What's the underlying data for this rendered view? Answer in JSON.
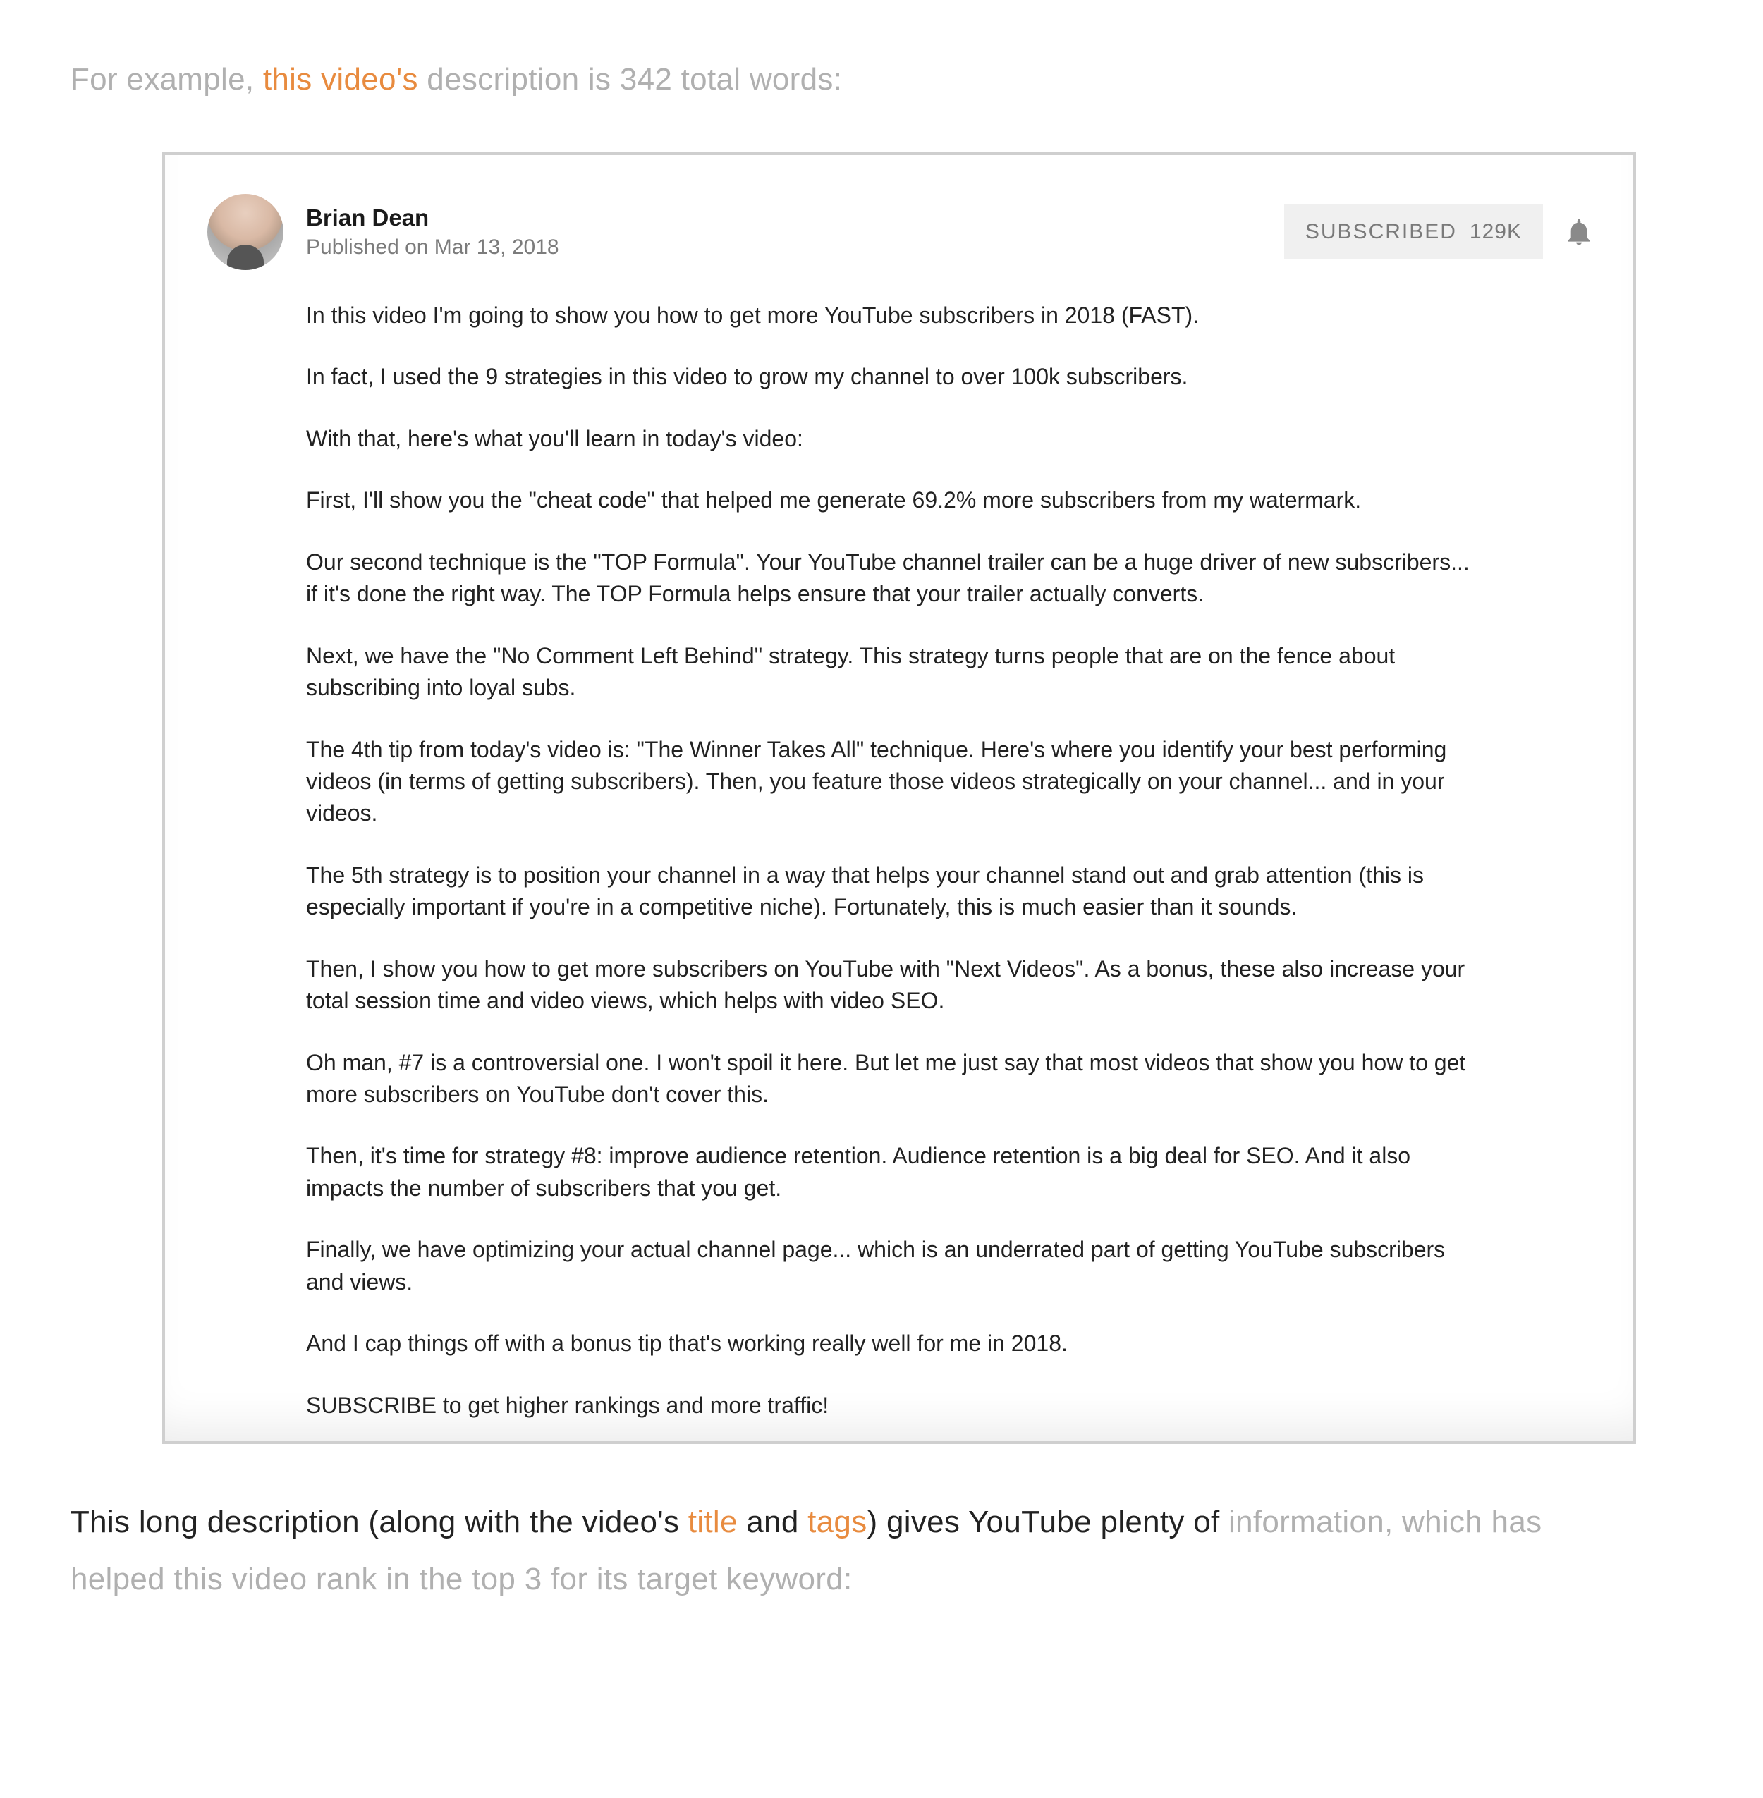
{
  "intro": {
    "before": "For example, ",
    "link": "this video's",
    "after": " description is 342 total words:"
  },
  "card": {
    "author": "Brian Dean",
    "published": "Published on Mar 13, 2018",
    "subscribed_label": "SUBSCRIBED",
    "sub_count": "129K",
    "paragraphs": [
      "In this video I'm going to show you how to get more YouTube subscribers in 2018 (FAST).",
      "In fact, I used the 9 strategies in this video to grow my channel to over 100k subscribers.",
      "With that, here's what you'll learn in today's video:",
      "First, I'll show you the \"cheat code\" that helped me generate 69.2% more subscribers from my watermark.",
      "Our second technique is the \"TOP Formula\". Your YouTube channel trailer can be a huge driver of new subscribers... if it's done the right way. The TOP Formula helps ensure that your trailer actually converts.",
      "Next, we have the \"No Comment Left Behind\" strategy. This strategy turns people that are on the fence about subscribing into loyal subs.",
      "The 4th tip from today's video is: \"The Winner Takes All\" technique. Here's where you identify your best performing videos (in terms of getting subscribers). Then, you feature those videos strategically on your channel... and in your videos.",
      "The 5th strategy is to position your channel in a way that helps your channel stand out and grab attention (this is especially important if you're in a competitive niche). Fortunately, this is much easier than it sounds.",
      "Then, I show you how to get more subscribers on YouTube with \"Next Videos\". As a bonus, these also increase your total session time and video views, which helps with video SEO.",
      "Oh man, #7 is a controversial one. I won't spoil it here. But let me just say that most videos that show you how to get more subscribers on YouTube don't cover this.",
      "Then, it's time for strategy #8: improve audience retention. Audience retention is a big deal for SEO. And it also impacts the number of subscribers that you get.",
      "Finally, we have optimizing your actual channel page... which is an underrated part of getting YouTube subscribers and views.",
      "And I cap things off with a bonus tip that's working really well for me in 2018.",
      "SUBSCRIBE to get higher rankings and more traffic!"
    ]
  },
  "outro": {
    "solid_before": "This long description (along with the video's ",
    "link_title": "title",
    "solid_mid": " and ",
    "link_tags": "tags",
    "solid_after": ") gives YouTube plenty of ",
    "faded": "information, which has helped this video rank in the top 3 for its target keyword:"
  }
}
